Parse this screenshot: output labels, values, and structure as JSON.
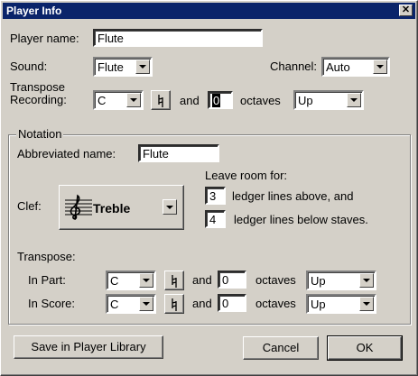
{
  "window": {
    "title": "Player Info",
    "close_glyph": "✕"
  },
  "player": {
    "name_label": "Player name:",
    "name_value": "Flute",
    "sound_label": "Sound:",
    "sound_value": "Flute",
    "channel_label": "Channel:",
    "channel_value": "Auto",
    "transpose_recording_label_1": "Transpose",
    "transpose_recording_label_2": "Recording:",
    "recording_key": "C",
    "and_label": "and",
    "recording_octaves": "0",
    "octaves_label": "octaves",
    "recording_direction": "Up"
  },
  "notation": {
    "group_title": "Notation",
    "abbrev_label": "Abbreviated name:",
    "abbrev_value": "Flute",
    "clef_label": "Clef:",
    "clef_value": "Treble",
    "leave_room_label": "Leave room for:",
    "ledger_above_value": "3",
    "ledger_above_label": "ledger lines above, and",
    "ledger_below_value": "4",
    "ledger_below_label": "ledger lines below staves.",
    "transpose_label": "Transpose:",
    "in_part_label": "In Part:",
    "in_part_key": "C",
    "in_part_octaves": "0",
    "in_part_direction": "Up",
    "in_score_label": "In Score:",
    "in_score_key": "C",
    "in_score_octaves": "0",
    "in_score_direction": "Up",
    "and_label": "and",
    "octaves_label": "octaves"
  },
  "buttons": {
    "save_library": "Save in Player Library",
    "cancel": "Cancel",
    "ok": "OK"
  },
  "icons": {
    "natural": "natural-sign-icon",
    "clef": "treble-clef-icon",
    "dropdown": "chevron-down-icon"
  }
}
